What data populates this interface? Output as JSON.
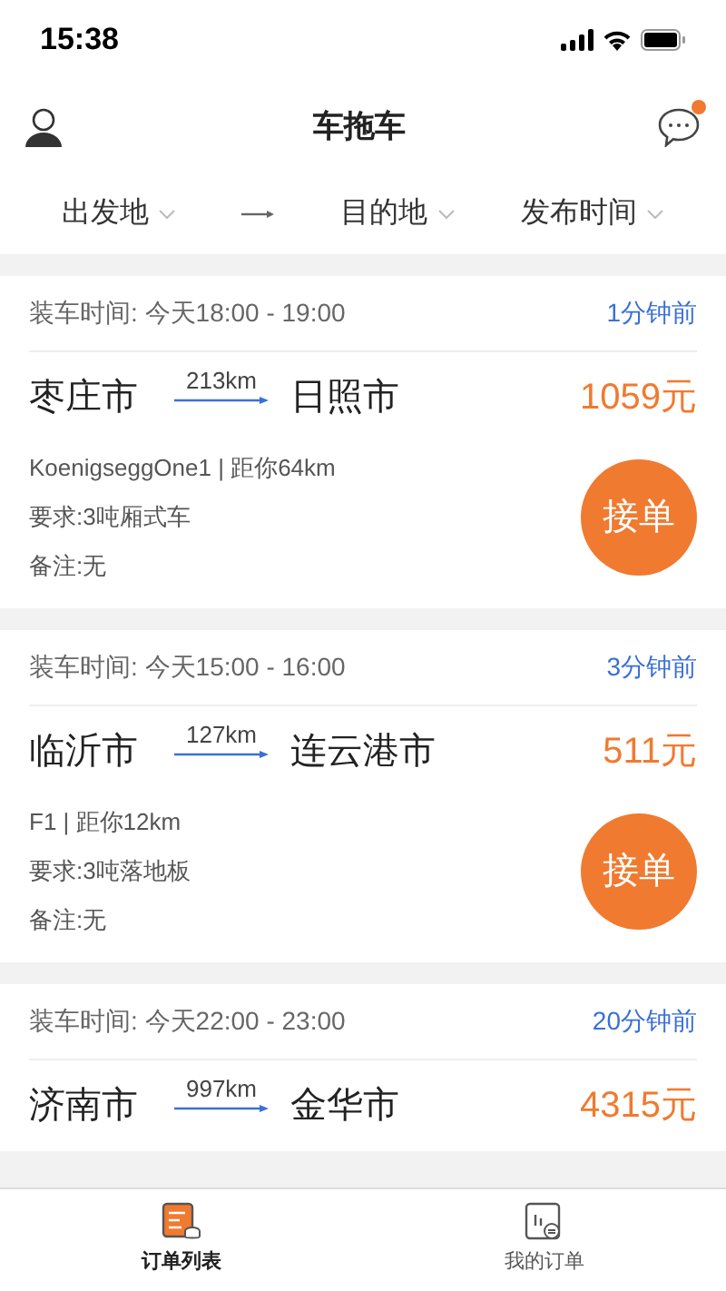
{
  "status_bar": {
    "time": "15:38"
  },
  "header": {
    "title": "车拖车",
    "has_notification": true
  },
  "filters": [
    {
      "label": "出发地"
    },
    {
      "label": "目的地"
    },
    {
      "label": "发布时间"
    }
  ],
  "orders": [
    {
      "load_time": "装车时间: 今天18:00 - 19:00",
      "posted": "1分钟前",
      "from": "枣庄市",
      "distance": "213km",
      "to": "日照市",
      "price": "1059元",
      "details": [
        "KoenigseggOne1 | 距你64km",
        "要求:3吨厢式车",
        "备注:无"
      ],
      "action": "接单"
    },
    {
      "load_time": "装车时间: 今天15:00 - 16:00",
      "posted": "3分钟前",
      "from": "临沂市",
      "distance": "127km",
      "to": "连云港市",
      "price": "511元",
      "details": [
        "F1 | 距你12km",
        "要求:3吨落地板",
        "备注:无"
      ],
      "action": "接单"
    },
    {
      "load_time": "装车时间: 今天22:00 - 23:00",
      "posted": "20分钟前",
      "from": "济南市",
      "distance": "997km",
      "to": "金华市",
      "price": "4315元"
    }
  ],
  "tab_bar": [
    {
      "label": "订单列表",
      "selected": true
    },
    {
      "label": "我的订单",
      "selected": false
    }
  ]
}
